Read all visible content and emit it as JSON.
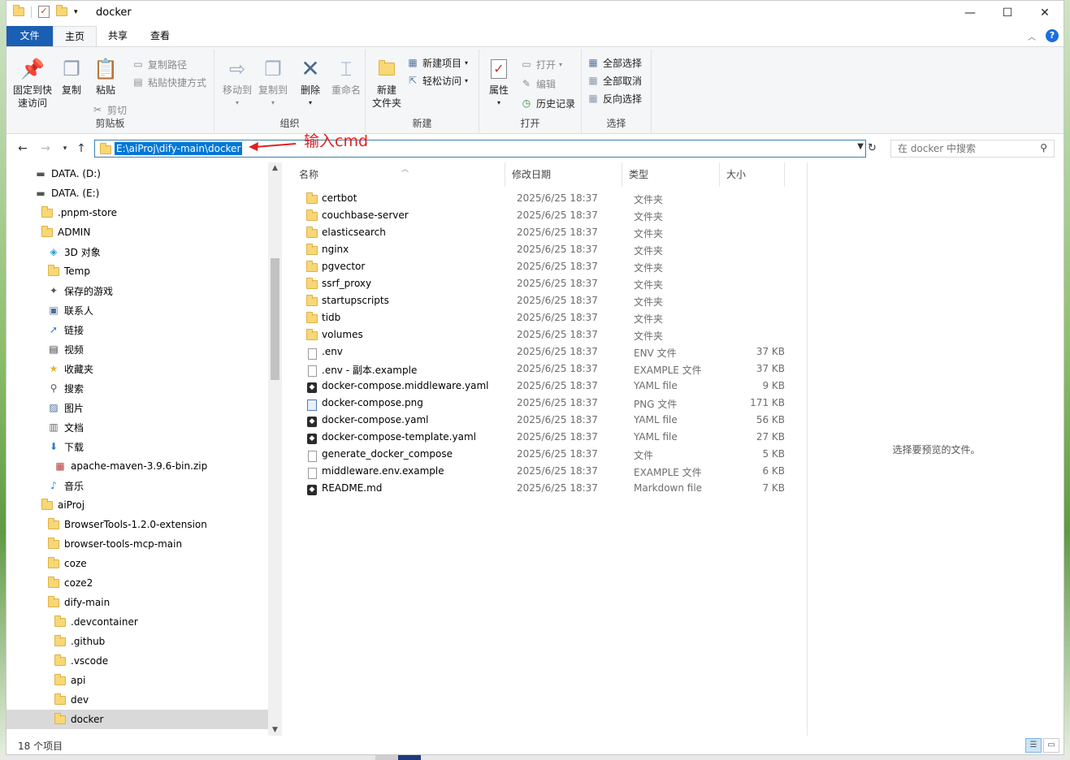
{
  "window": {
    "title": "docker",
    "controls": {
      "minimize": "—",
      "maximize": "☐",
      "close": "✕"
    }
  },
  "ribbon": {
    "tabs": [
      {
        "label": "文件"
      },
      {
        "label": "主页"
      },
      {
        "label": "共享"
      },
      {
        "label": "查看"
      }
    ],
    "clipboard": {
      "label": "剪贴板",
      "pin": "固定到快\n速访问",
      "copy": "复制",
      "paste": "粘贴",
      "copy_path": "复制路径",
      "paste_shortcut": "粘贴快捷方式",
      "cut": "剪切"
    },
    "organize": {
      "label": "组织",
      "move_to": "移动到",
      "copy_to": "复制到",
      "delete": "删除",
      "rename": "重命名"
    },
    "new": {
      "label": "新建",
      "new_folder": "新建\n文件夹",
      "new_item": "新建项目",
      "easy_access": "轻松访问"
    },
    "open": {
      "label": "打开",
      "properties": "属性",
      "open": "打开",
      "edit": "编辑",
      "history": "历史记录"
    },
    "select": {
      "label": "选择",
      "select_all": "全部选择",
      "select_none": "全部取消",
      "invert": "反向选择"
    }
  },
  "address": {
    "path": "E:\\aiProj\\dify-main\\docker",
    "search_placeholder": "在 docker 中搜索"
  },
  "annotation": {
    "text": "输入cmd",
    "color": "#e02020"
  },
  "nav_tree": [
    {
      "label": "DATA. (D:)",
      "icon": "drive-icon",
      "indent": 34
    },
    {
      "label": "DATA. (E:)",
      "icon": "drive-icon",
      "indent": 34
    },
    {
      "label": ".pnpm-store",
      "icon": "folder-icon",
      "indent": 42
    },
    {
      "label": "ADMIN",
      "icon": "folder-icon",
      "indent": 42
    },
    {
      "label": "3D 对象",
      "icon": "cube-icon",
      "indent": 50
    },
    {
      "label": "Temp",
      "icon": "folder-icon",
      "indent": 50
    },
    {
      "label": "保存的游戏",
      "icon": "gamepad-icon",
      "indent": 50
    },
    {
      "label": "联系人",
      "icon": "contacts-icon",
      "indent": 50
    },
    {
      "label": "链接",
      "icon": "link-icon",
      "indent": 50
    },
    {
      "label": "视频",
      "icon": "video-icon",
      "indent": 50
    },
    {
      "label": "收藏夹",
      "icon": "star-icon",
      "indent": 50
    },
    {
      "label": "搜索",
      "icon": "search-icon",
      "indent": 50
    },
    {
      "label": "图片",
      "icon": "picture-icon",
      "indent": 50
    },
    {
      "label": "文档",
      "icon": "document-icon",
      "indent": 50
    },
    {
      "label": "下载",
      "icon": "download-icon",
      "indent": 50
    },
    {
      "label": "apache-maven-3.9.6-bin.zip",
      "icon": "zip-icon",
      "indent": 58
    },
    {
      "label": "音乐",
      "icon": "music-icon",
      "indent": 50
    },
    {
      "label": "aiProj",
      "icon": "folder-icon",
      "indent": 42
    },
    {
      "label": "BrowserTools-1.2.0-extension",
      "icon": "folder-icon",
      "indent": 50
    },
    {
      "label": "browser-tools-mcp-main",
      "icon": "folder-icon",
      "indent": 50
    },
    {
      "label": "coze",
      "icon": "folder-icon",
      "indent": 50
    },
    {
      "label": "coze2",
      "icon": "folder-icon",
      "indent": 50
    },
    {
      "label": "dify-main",
      "icon": "folder-icon",
      "indent": 50
    },
    {
      "label": ".devcontainer",
      "icon": "folder-icon",
      "indent": 58
    },
    {
      "label": ".github",
      "icon": "folder-icon",
      "indent": 58
    },
    {
      "label": ".vscode",
      "icon": "folder-icon",
      "indent": 58
    },
    {
      "label": "api",
      "icon": "folder-icon",
      "indent": 58
    },
    {
      "label": "dev",
      "icon": "folder-icon",
      "indent": 58
    },
    {
      "label": "docker",
      "icon": "folder-icon",
      "indent": 58,
      "selected": true
    }
  ],
  "columns": {
    "name": "名称",
    "date": "修改日期",
    "type": "类型",
    "size": "大小"
  },
  "files": [
    {
      "name": "certbot",
      "date": "2025/6/25 18:37",
      "type": "文件夹",
      "size": "",
      "icon": "folder"
    },
    {
      "name": "couchbase-server",
      "date": "2025/6/25 18:37",
      "type": "文件夹",
      "size": "",
      "icon": "folder"
    },
    {
      "name": "elasticsearch",
      "date": "2025/6/25 18:37",
      "type": "文件夹",
      "size": "",
      "icon": "folder"
    },
    {
      "name": "nginx",
      "date": "2025/6/25 18:37",
      "type": "文件夹",
      "size": "",
      "icon": "folder"
    },
    {
      "name": "pgvector",
      "date": "2025/6/25 18:37",
      "type": "文件夹",
      "size": "",
      "icon": "folder"
    },
    {
      "name": "ssrf_proxy",
      "date": "2025/6/25 18:37",
      "type": "文件夹",
      "size": "",
      "icon": "folder"
    },
    {
      "name": "startupscripts",
      "date": "2025/6/25 18:37",
      "type": "文件夹",
      "size": "",
      "icon": "folder"
    },
    {
      "name": "tidb",
      "date": "2025/6/25 18:37",
      "type": "文件夹",
      "size": "",
      "icon": "folder"
    },
    {
      "name": "volumes",
      "date": "2025/6/25 18:37",
      "type": "文件夹",
      "size": "",
      "icon": "folder"
    },
    {
      "name": ".env",
      "date": "2025/6/25 18:37",
      "type": "ENV 文件",
      "size": "37 KB",
      "icon": "doc"
    },
    {
      "name": ".env - 副本.example",
      "date": "2025/6/25 18:37",
      "type": "EXAMPLE 文件",
      "size": "37 KB",
      "icon": "doc"
    },
    {
      "name": "docker-compose.middleware.yaml",
      "date": "2025/6/25 18:37",
      "type": "YAML file",
      "size": "9 KB",
      "icon": "yaml"
    },
    {
      "name": "docker-compose.png",
      "date": "2025/6/25 18:37",
      "type": "PNG 文件",
      "size": "171 KB",
      "icon": "png"
    },
    {
      "name": "docker-compose.yaml",
      "date": "2025/6/25 18:37",
      "type": "YAML file",
      "size": "56 KB",
      "icon": "yaml"
    },
    {
      "name": "docker-compose-template.yaml",
      "date": "2025/6/25 18:37",
      "type": "YAML file",
      "size": "27 KB",
      "icon": "yaml"
    },
    {
      "name": "generate_docker_compose",
      "date": "2025/6/25 18:37",
      "type": "文件",
      "size": "5 KB",
      "icon": "doc"
    },
    {
      "name": "middleware.env.example",
      "date": "2025/6/25 18:37",
      "type": "EXAMPLE 文件",
      "size": "6 KB",
      "icon": "doc"
    },
    {
      "name": "README.md",
      "date": "2025/6/25 18:37",
      "type": "Markdown file",
      "size": "7 KB",
      "icon": "yaml"
    }
  ],
  "preview": {
    "empty_text": "选择要预览的文件。"
  },
  "status": {
    "count": "18 个项目"
  }
}
